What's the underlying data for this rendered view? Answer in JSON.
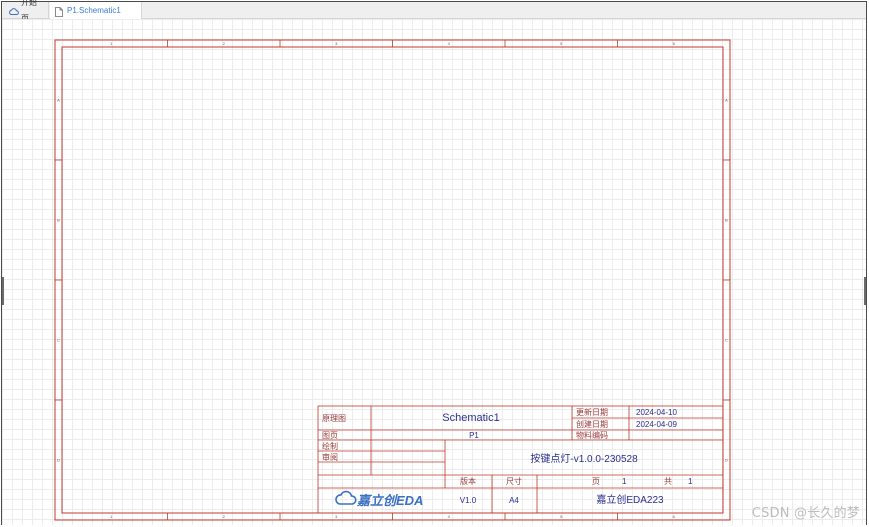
{
  "tabs": [
    {
      "label": "开始页",
      "icon": "cloud-icon",
      "active": false
    },
    {
      "label": "P1.Schematic1",
      "icon": "document-icon",
      "active": true
    }
  ],
  "sheet": {
    "columns": [
      "1",
      "2",
      "3",
      "4",
      "5",
      "6"
    ],
    "rows": [
      "A",
      "B",
      "C",
      "D"
    ],
    "border_color": "#c0392b",
    "title_block": {
      "schematic_label": "原理图",
      "schematic_name": "Schematic1",
      "sheet_label": "图页",
      "sheet_name": "P1",
      "drawn_label": "绘制",
      "review_label": "审阅",
      "project_name": "按键点灯-v1.0.0-230528",
      "update_date_label": "更新日期",
      "update_date": "2024-04-10",
      "create_date_label": "创建日期",
      "create_date": "2024-04-09",
      "part_code_label": "物料编码",
      "version_label": "版本",
      "version": "V1.0",
      "size_label": "尺寸",
      "size": "A4",
      "page_label": "页",
      "page": "1",
      "total_label": "共",
      "total": "1",
      "logo_text": "嘉立创EDA",
      "company": "嘉立创EDA223"
    }
  },
  "watermark": "CSDN @长久的梦"
}
